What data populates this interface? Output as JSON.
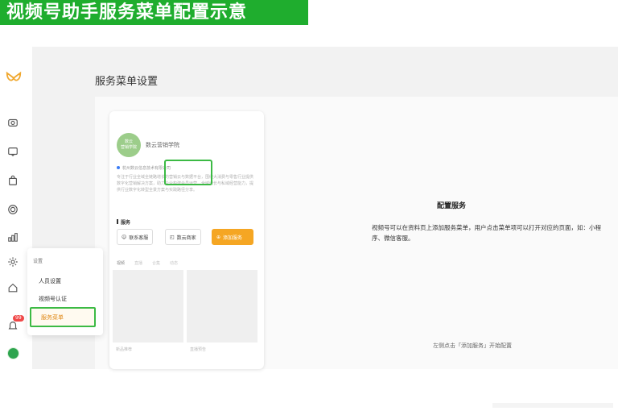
{
  "banner": {
    "title": "视频号助手服务菜单配置示意"
  },
  "page": {
    "title": "服务菜单设置"
  },
  "sidebar": {
    "icons": [
      "camera-icon",
      "chat-icon",
      "bag-icon",
      "target-icon",
      "chart-icon",
      "gear-icon",
      "home-icon",
      "bell-icon"
    ],
    "badge": "99"
  },
  "popup": {
    "heading": "设置",
    "items": [
      "人员设置",
      "视频号认证",
      "服务菜单"
    ]
  },
  "phone": {
    "avatar_text": "数云\n营销学院",
    "name": "数云营销学院",
    "org": "杭州数云信息技术有限公司",
    "desc": "专注于行业全域全链路增长的营销云与数据平台，围绕大消费与零售行业提供数字化营销解决方案，助力企业构建会员运营、全域增长与私域经营能力，提供行业数字化转型全景方案与实践路径分享。",
    "service_label": "服务",
    "services": [
      "联系客服",
      "数云商家",
      "添加服务"
    ],
    "tabs": [
      "视频",
      "直播",
      "合集",
      "动态"
    ],
    "tile_captions": [
      "新品推荐",
      "直播预告"
    ]
  },
  "config": {
    "title": "配置服务",
    "desc": "视频号可以在资料页上添加服务菜单，用户点击菜单项可以打开对应的页面，如：小程序、微信客服。",
    "hint": "左侧点击「添加服务」开始配置"
  },
  "colors": {
    "accent": "#1fad2e",
    "highlight": "#3cba44",
    "orange": "#f5a623"
  }
}
